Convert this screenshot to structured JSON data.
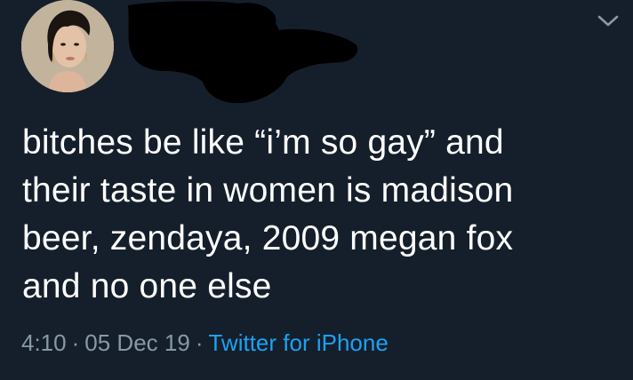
{
  "tweet": {
    "text": "bitches be like “i’m so gay” and\ntheir taste in women is madison\nbeer, zendaya, 2009 megan fox\nand no one else",
    "time": "4:10",
    "date": "05 Dec 19",
    "source": "Twitter for iPhone",
    "separator": "·"
  },
  "icons": {
    "menu": "chevron-down-icon"
  },
  "colors": {
    "background": "#151f2b",
    "text": "#ffffff",
    "meta": "#8899a6",
    "link": "#1da1f2"
  }
}
